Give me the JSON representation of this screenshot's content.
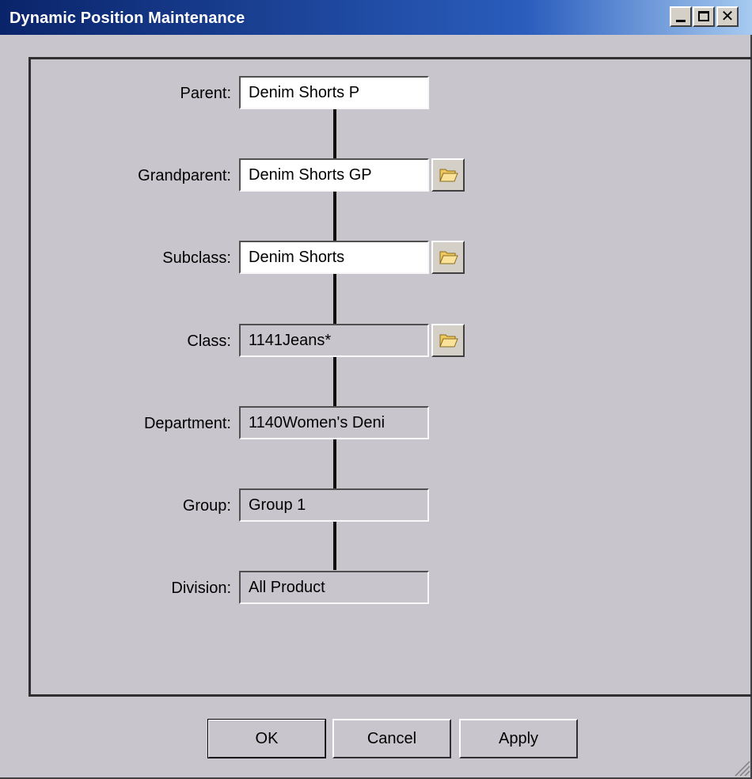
{
  "window": {
    "title": "Dynamic Position Maintenance",
    "controls": {
      "minimize": "_",
      "maximize": "□",
      "close": "✕"
    }
  },
  "hierarchy": [
    {
      "label": "Parent:",
      "value": "Denim Shorts P",
      "editable": true,
      "browse": false
    },
    {
      "label": "Grandparent:",
      "value": "Denim Shorts GP",
      "editable": true,
      "browse": true
    },
    {
      "label": "Subclass:",
      "value": "Denim Shorts",
      "editable": true,
      "browse": true
    },
    {
      "label": "Class:",
      "value": "1141Jeans*",
      "editable": false,
      "browse": true
    },
    {
      "label": "Department:",
      "value": "1140Women's Deni",
      "editable": false,
      "browse": false
    },
    {
      "label": "Group:",
      "value": "Group 1",
      "editable": false,
      "browse": false
    },
    {
      "label": "Division:",
      "value": "All Product",
      "editable": false,
      "browse": false
    }
  ],
  "buttons": {
    "ok": "OK",
    "cancel": "Cancel",
    "apply": "Apply"
  },
  "icons": {
    "browse": "folder-open-icon",
    "resize": "resize-grip-icon"
  },
  "colors": {
    "titlebar_start": "#0a246a",
    "titlebar_end": "#a6caf0",
    "face": "#c8c6cc",
    "folder": "#f5d67a"
  }
}
